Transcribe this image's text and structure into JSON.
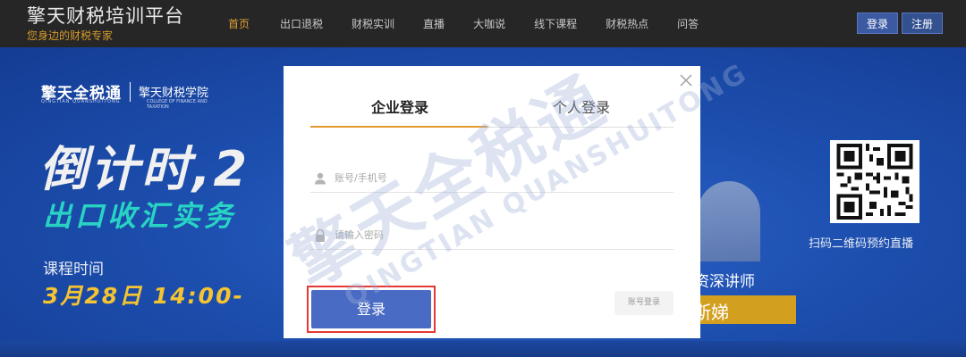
{
  "header": {
    "brand_title": "擎天财税培训平台",
    "brand_subtitle": "您身边的财税专家",
    "nav": [
      {
        "label": "首页",
        "active": true
      },
      {
        "label": "出口退税",
        "active": false
      },
      {
        "label": "财税实训",
        "active": false
      },
      {
        "label": "直播",
        "active": false
      },
      {
        "label": "大咖说",
        "active": false
      },
      {
        "label": "线下课程",
        "active": false
      },
      {
        "label": "财税热点",
        "active": false
      },
      {
        "label": "问答",
        "active": false
      }
    ],
    "login_label": "登录",
    "register_label": "注册"
  },
  "banner": {
    "logo_main": "擎天全税通",
    "logo_school": "擎天财税学院",
    "logo_pinyin": "QINGTIAN QUANSHUITONG",
    "logo_school_en": "COLLEGE OF FINANCE AND TAXATION",
    "headline": "倒计时,2",
    "subline": "出口收汇实务",
    "course_label": "课程时间",
    "course_time": "3月28日 14:00-",
    "qr_caption": "扫码二维码预约直播",
    "speaker_title": "资深讲师",
    "speaker_name": "斯娣"
  },
  "modal": {
    "tabs": [
      {
        "label": "企业登录",
        "active": true
      },
      {
        "label": "个人登录",
        "active": false
      }
    ],
    "username_placeholder": "账号/手机号",
    "password_placeholder": "请输入密码",
    "login_button": "登录",
    "account_login_button": "账号登录"
  },
  "watermark": {
    "text_cn": "擎天全税通",
    "text_en": "QINGTIAN QUANSHUITONG"
  },
  "colors": {
    "nav_bg": "#262626",
    "accent_orange": "#e29a2e",
    "primary_blue": "#4a6bc4",
    "banner_blue": "#1d4faf",
    "highlight_red": "#e53935"
  }
}
